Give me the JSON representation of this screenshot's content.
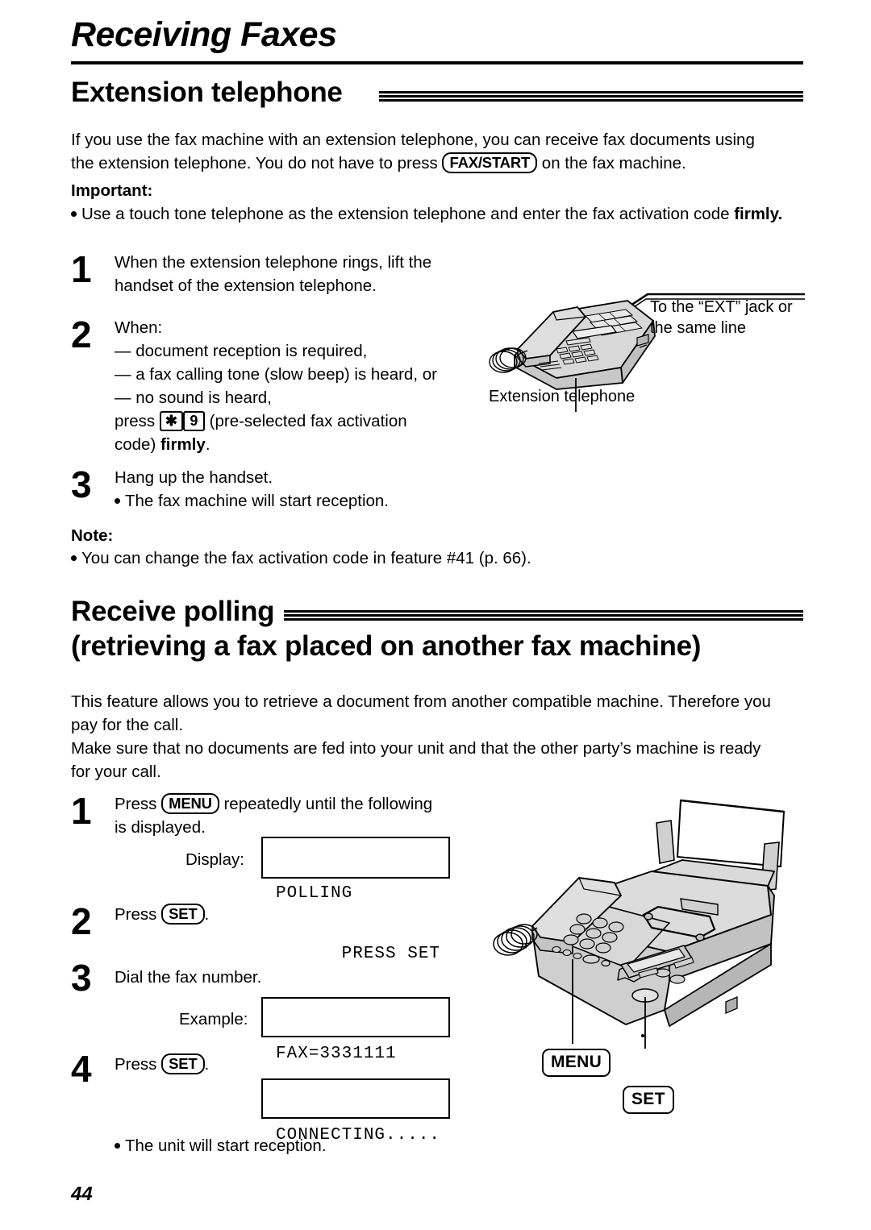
{
  "page": {
    "number": "44",
    "chapter_title": "Receiving Faxes"
  },
  "section_extension": {
    "heading": "Extension telephone",
    "intro_line1": "If you use the fax machine with an extension telephone, you can receive fax documents using",
    "intro_line2_a": "the extension telephone. You do not have to press",
    "intro_key": "FAX/START",
    "intro_line2_b": "on the fax machine.",
    "important_label": "Important:",
    "important_text_a": "Use a touch tone telephone as the extension telephone and enter the fax activation code ",
    "important_text_bold": "firmly.",
    "steps": [
      {
        "num": "1",
        "line1": "When the extension telephone rings, lift the",
        "line2": "handset of the extension telephone."
      },
      {
        "num": "2",
        "line1": "When:",
        "line2": "— document reception is required,",
        "line3": "— a fax calling tone (slow beep) is heard, or",
        "line4": "— no sound is heard,",
        "line5_a": "press",
        "key1": "✱",
        "key2": "9",
        "line5_b": "(pre-selected fax activation",
        "line6_a": "code)",
        "line6_bold": "firmly",
        "line6_b": "."
      },
      {
        "num": "3",
        "line1": "Hang up the handset.",
        "line2": "The fax machine will start reception."
      }
    ],
    "note_label": "Note:",
    "note_text": "You can change the fax activation code in feature #41 (p. 66).",
    "figure": {
      "label_ext_jack_line1": "To the “EXT” jack or",
      "label_ext_jack_line2": "the same line",
      "label_phone": "Extension telephone"
    }
  },
  "section_polling": {
    "heading_line1": "Receive polling",
    "heading_line2": "(retrieving a fax placed on another fax machine)",
    "intro_line1": "This feature allows you to retrieve a document from another compatible machine. Therefore you",
    "intro_line2": "pay for the call.",
    "intro_line3": "Make sure that no documents are fed into your unit and that the other party’s machine is ready",
    "intro_line4": "for your call.",
    "steps": [
      {
        "num": "1",
        "line1_a": "Press",
        "key": "MENU",
        "line1_b": "repeatedly until the following",
        "line2": "is displayed.",
        "display_label": "Display:",
        "display_line1": "POLLING",
        "display_line2": "      PRESS SET"
      },
      {
        "num": "2",
        "line1_a": "Press",
        "key": "SET",
        "line1_b": "."
      },
      {
        "num": "3",
        "line1": "Dial the fax number.",
        "display_label": "Example:",
        "display_line1": "FAX=3331111"
      },
      {
        "num": "4",
        "line1_a": "Press",
        "key": "SET",
        "line1_b": ".",
        "display_line1": "CONNECTING....."
      }
    ],
    "final_bullet": "The unit will start reception.",
    "figure": {
      "callout_menu": "MENU",
      "callout_set": "SET"
    }
  },
  "colors": {
    "ink": "#000000",
    "paper": "#ffffff",
    "illustration_fill": "#d2d2d2",
    "illustration_fill_light": "#e6e6e6",
    "illustration_fill_dark": "#b4b4b4"
  }
}
